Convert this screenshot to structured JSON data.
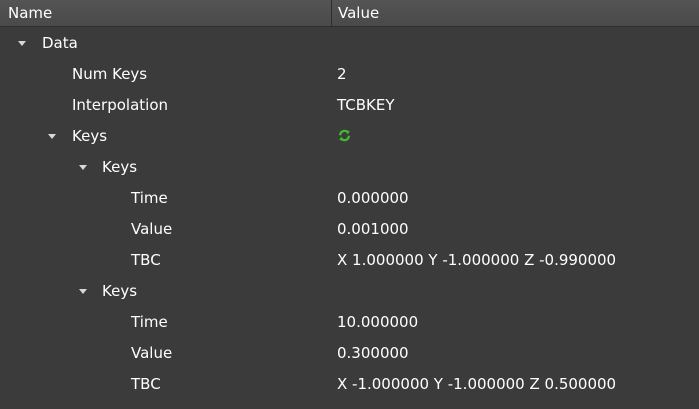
{
  "header": {
    "name": "Name",
    "value": "Value"
  },
  "rows": [
    {
      "name": "Data",
      "value": "",
      "expanded": true
    },
    {
      "name": "Num Keys",
      "value": "2"
    },
    {
      "name": "Interpolation",
      "value": "TCBKEY"
    },
    {
      "name": "Keys",
      "value": "",
      "icon": "refresh-icon",
      "expanded": true
    },
    {
      "name": "Keys",
      "value": "",
      "expanded": true
    },
    {
      "name": "Time",
      "value": "0.000000"
    },
    {
      "name": "Value",
      "value": "0.001000"
    },
    {
      "name": "TBC",
      "value": "X 1.000000 Y -1.000000 Z -0.990000"
    },
    {
      "name": "Keys",
      "value": "",
      "expanded": true
    },
    {
      "name": "Time",
      "value": "10.000000"
    },
    {
      "name": "Value",
      "value": "0.300000"
    },
    {
      "name": "TBC",
      "value": "X -1.000000 Y -1.000000 Z 0.500000"
    }
  ],
  "colors": {
    "background": "#3b3b3b",
    "header": "#4d4d4d",
    "text": "#ffffff",
    "icon_green": "#3fbf2a"
  }
}
